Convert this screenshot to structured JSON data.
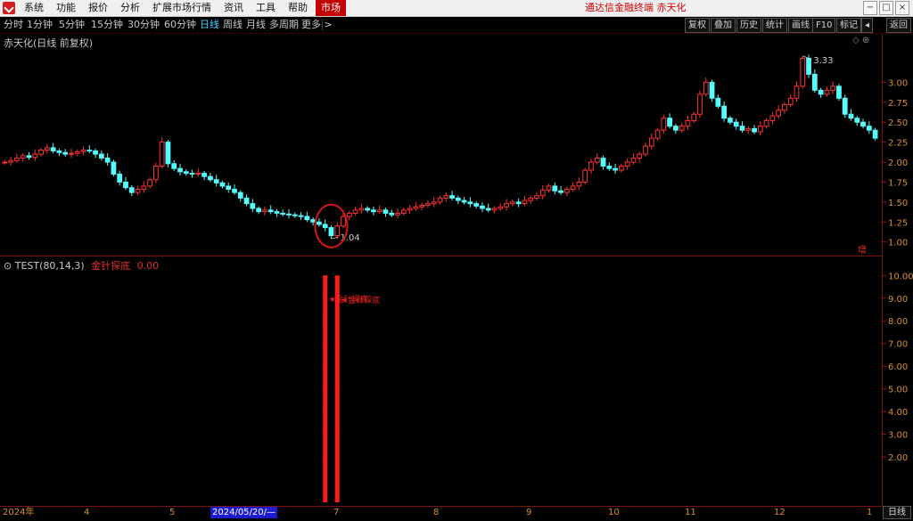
{
  "menubar": {
    "items": [
      "系统",
      "功能",
      "报价",
      "分析",
      "扩展市场行情",
      "资讯",
      "工具",
      "帮助"
    ],
    "market": "市场",
    "title": "通达信金融终端 赤天化"
  },
  "window": {
    "minimize": "−",
    "maximize": "□",
    "close": "×"
  },
  "toolbar": {
    "periods": [
      "分时",
      "1分钟",
      "5分钟",
      "15分钟",
      "30分钟",
      "60分钟",
      "日线",
      "周线",
      "月线",
      "多周期",
      "更多 >"
    ],
    "active_period": "日线",
    "tools": [
      "复权",
      "叠加",
      "历史",
      "统计",
      "画线",
      "F10",
      "标记",
      "◂",
      "返回"
    ]
  },
  "stock": {
    "name": "赤天化(日线 前复权)",
    "right_icons": "◇ ⊕"
  },
  "main_chart": {
    "type": "candlestick",
    "yticks": [
      "3.00",
      "2.75",
      "2.50",
      "2.25",
      "2.00",
      "1.75",
      "1.50",
      "1.25",
      "1.00"
    ],
    "y_range": [
      0.93,
      3.45
    ],
    "high_label": "3.33",
    "low_label": "1.04",
    "corner_mark": "增",
    "colors": {
      "up": "#ff3232",
      "down": "#54ffff",
      "grid": "#5a0000"
    }
  },
  "indicator": {
    "title": "TEST(80,14,3)",
    "name": "金针探底",
    "value": "0.00",
    "signal_label": "金针探底",
    "yticks": [
      "10.00",
      "9.00",
      "8.00",
      "7.00",
      "6.00",
      "5.00",
      "4.00",
      "3.00",
      "2.00"
    ],
    "y_range": [
      0,
      10.6
    ]
  },
  "xaxis": {
    "labels": [
      "2024年",
      "4",
      "5",
      "2024/05/20/—",
      "7",
      "8",
      "9",
      "10",
      "11",
      "12",
      "1"
    ],
    "selected_label": "2024/05/20/—",
    "day_tab": "日线"
  },
  "chart_data": {
    "type": "candlestick",
    "close_series": [
      2.0,
      2.02,
      2.05,
      2.08,
      2.06,
      2.1,
      2.15,
      2.18,
      2.14,
      2.12,
      2.1,
      2.11,
      2.13,
      2.15,
      2.14,
      2.1,
      2.05,
      2.0,
      1.85,
      1.75,
      1.68,
      1.62,
      1.66,
      1.7,
      1.78,
      1.95,
      2.25,
      1.98,
      1.92,
      1.88,
      1.86,
      1.85,
      1.86,
      1.82,
      1.78,
      1.74,
      1.7,
      1.66,
      1.62,
      1.55,
      1.48,
      1.42,
      1.38,
      1.4,
      1.38,
      1.36,
      1.35,
      1.34,
      1.33,
      1.32,
      1.28,
      1.25,
      1.22,
      1.18,
      1.08,
      1.2,
      1.32,
      1.36,
      1.4,
      1.42,
      1.4,
      1.38,
      1.4,
      1.36,
      1.34,
      1.36,
      1.4,
      1.42,
      1.44,
      1.46,
      1.48,
      1.5,
      1.55,
      1.58,
      1.55,
      1.52,
      1.5,
      1.48,
      1.45,
      1.42,
      1.4,
      1.42,
      1.44,
      1.48,
      1.5,
      1.48,
      1.52,
      1.55,
      1.58,
      1.65,
      1.7,
      1.64,
      1.62,
      1.66,
      1.7,
      1.75,
      1.9,
      2.0,
      2.05,
      1.95,
      1.92,
      1.9,
      1.95,
      2.0,
      2.05,
      2.1,
      2.2,
      2.3,
      2.4,
      2.55,
      2.45,
      2.4,
      2.45,
      2.52,
      2.6,
      2.85,
      3.0,
      2.8,
      2.7,
      2.55,
      2.5,
      2.45,
      2.4,
      2.42,
      2.38,
      2.45,
      2.52,
      2.58,
      2.65,
      2.72,
      2.8,
      2.95,
      3.3,
      3.1,
      2.9,
      2.85,
      2.9,
      2.95,
      2.8,
      2.6,
      2.55,
      2.5,
      2.45,
      2.4,
      2.3
    ],
    "high": 3.33,
    "low": 1.04,
    "indicator_signals": [
      {
        "index": 53,
        "value": 10
      },
      {
        "index": 55,
        "value": 10
      }
    ]
  }
}
